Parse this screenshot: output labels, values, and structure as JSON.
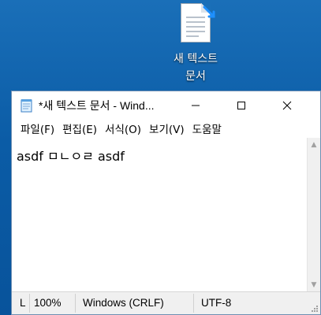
{
  "desktop": {
    "icon_label_line1": "새 텍스트",
    "icon_label_line2": "문서"
  },
  "window": {
    "title": "*새 텍스트 문서 - Wind...",
    "controls": {
      "minimize": "─",
      "maximize": "☐",
      "close": "✕"
    }
  },
  "menu": {
    "items": [
      "파일(F)",
      "편집(E)",
      "서식(O)",
      "보기(V)",
      "도움말"
    ]
  },
  "editor": {
    "content": "asdf ㅁㄴㅇㄹ asdf"
  },
  "statusbar": {
    "position": "L",
    "zoom": "100%",
    "line_ending": "Windows (CRLF)",
    "encoding": "UTF-8"
  },
  "colors": {
    "desktop_bg": "#0b5ca6",
    "window_border": "#6e8fb3",
    "statusbar_bg": "#f0f0f0"
  },
  "icons": {
    "desktop_icon": "text-document-icon",
    "shortcut_badge": "new-badge-icon",
    "app_icon": "notepad-icon"
  }
}
